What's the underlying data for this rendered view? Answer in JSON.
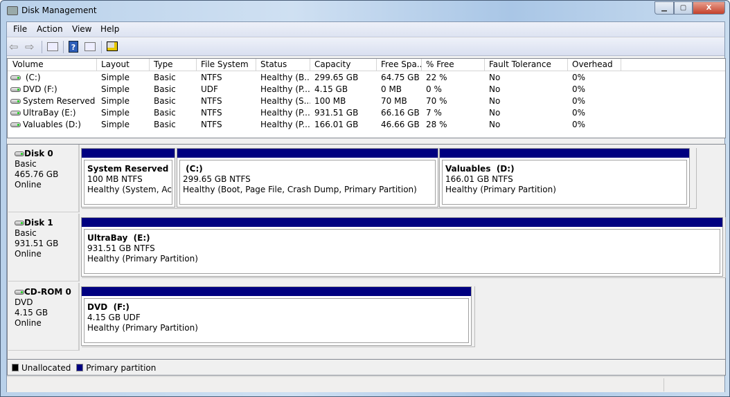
{
  "window": {
    "title": "Disk Management",
    "controls": {
      "minimize": "▁",
      "maximize": "▢",
      "close": "X"
    }
  },
  "menu": [
    "File",
    "Action",
    "View",
    "Help"
  ],
  "toolbar": {
    "help_label": "?",
    "icons": [
      "back-arrow-icon",
      "forward-arrow-icon",
      "show-hide-console-tree-icon",
      "help-icon",
      "show-hide-action-pane-icon",
      "properties-icon"
    ]
  },
  "volume_list": {
    "columns": [
      "Volume",
      "Layout",
      "Type",
      "File System",
      "Status",
      "Capacity",
      "Free Spa...",
      "% Free",
      "Fault Tolerance",
      "Overhead"
    ],
    "rows": [
      [
        " (C:)",
        "Simple",
        "Basic",
        "NTFS",
        "Healthy (B...",
        "299.65 GB",
        "64.75 GB",
        "22 %",
        "No",
        "0%"
      ],
      [
        "DVD (F:)",
        "Simple",
        "Basic",
        "UDF",
        "Healthy (P...",
        "4.15 GB",
        "0 MB",
        "0 %",
        "No",
        "0%"
      ],
      [
        "System Reserved",
        "Simple",
        "Basic",
        "NTFS",
        "Healthy (S...",
        "100 MB",
        "70 MB",
        "70 %",
        "No",
        "0%"
      ],
      [
        "UltraBay (E:)",
        "Simple",
        "Basic",
        "NTFS",
        "Healthy (P...",
        "931.51 GB",
        "66.16 GB",
        "7 %",
        "No",
        "0%"
      ],
      [
        "Valuables (D:)",
        "Simple",
        "Basic",
        "NTFS",
        "Healthy (P...",
        "166.01 GB",
        "46.66 GB",
        "28 %",
        "No",
        "0%"
      ]
    ],
    "row_icons": [
      "hard-drive-icon",
      "dvd-drive-icon",
      "hard-drive-icon",
      "hard-drive-icon",
      "hard-drive-icon"
    ]
  },
  "disks": [
    {
      "name": "Disk 0",
      "type": "Basic",
      "size": "465.76 GB",
      "status": "Online",
      "partitions": [
        {
          "name": "System Reserved",
          "size": "100 MB NTFS",
          "status": "Healthy (System, Active"
        },
        {
          "name": " (C:)",
          "size": "299.65 GB NTFS",
          "status": "Healthy (Boot, Page File, Crash Dump, Primary Partition)"
        },
        {
          "name": "Valuables  (D:)",
          "size": "166.01 GB NTFS",
          "status": "Healthy (Primary Partition)"
        }
      ]
    },
    {
      "name": "Disk 1",
      "type": "Basic",
      "size": "931.51 GB",
      "status": "Online",
      "partitions": [
        {
          "name": "UltraBay  (E:)",
          "size": "931.51 GB NTFS",
          "status": "Healthy (Primary Partition)"
        }
      ]
    },
    {
      "name": "CD-ROM 0",
      "type": "DVD",
      "size": "4.15 GB",
      "status": "Online",
      "partitions": [
        {
          "name": "DVD  (F:)",
          "size": "4.15 GB UDF",
          "status": "Healthy (Primary Partition)"
        }
      ]
    }
  ],
  "legend": [
    {
      "label": "Unallocated",
      "color": "#000000"
    },
    {
      "label": "Primary partition",
      "color": "#000080"
    }
  ]
}
